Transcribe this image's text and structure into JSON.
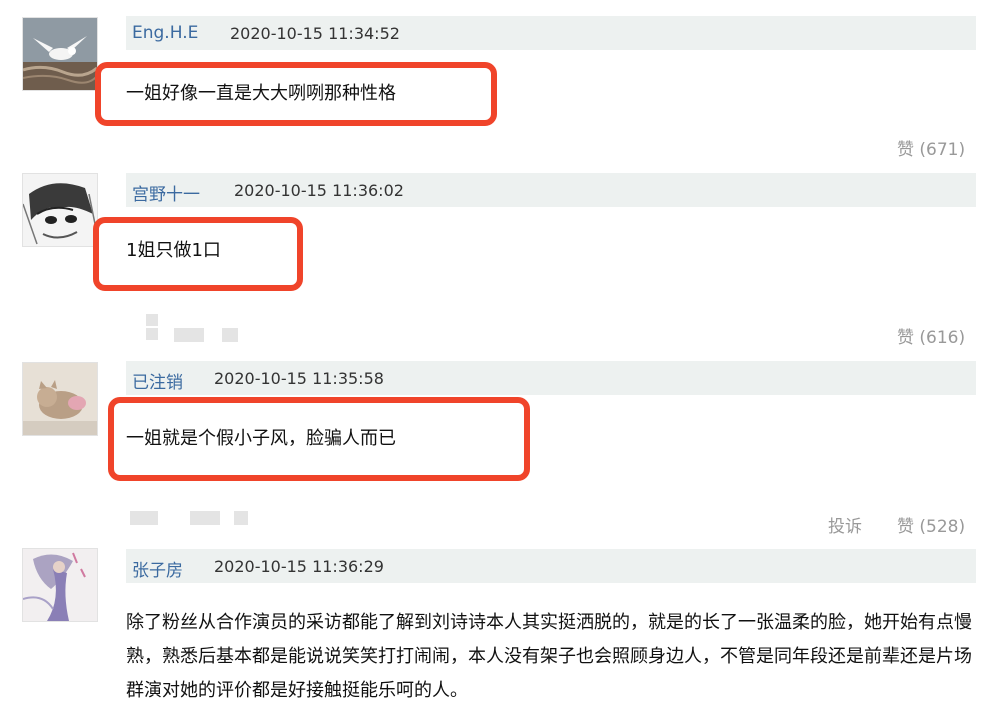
{
  "comments": [
    {
      "username": "Eng.H.E",
      "time": "2020-10-15 11:34:52",
      "content": "一姐好像一直是大大咧咧那种性格",
      "like_label": "赞 (671)",
      "avatar_icon": "seagull-avatar-icon"
    },
    {
      "username": "宫野十一",
      "time": "2020-10-15 11:36:02",
      "content": "1姐只做1口",
      "like_label": "赞 (616)",
      "avatar_icon": "manga-sketch-avatar-icon"
    },
    {
      "username": "已注销",
      "time": "2020-10-15 11:35:58",
      "content": "一姐就是个假小子风，脸骗人而已",
      "like_label": "赞 (528)",
      "report_label": "投诉",
      "avatar_icon": "cat-avatar-icon"
    },
    {
      "username": "张子房",
      "time": "2020-10-15 11:36:29",
      "content": "除了粉丝从合作演员的采访都能了解到刘诗诗本人其实挺洒脱的，就是的长了一张温柔的脸，她开始有点慢熟，熟悉后基本都是能说说笑笑打打闹闹，本人没有架子也会照顾身边人，不管是同年段还是前辈还是片场群演对她的评价都是好接触挺能乐呵的人。",
      "avatar_icon": "illustration-avatar-icon"
    }
  ],
  "colors": {
    "username": "#3b6aa0",
    "header_bg": "#edf1f0",
    "highlight": "#f0442a",
    "action": "#999999"
  }
}
